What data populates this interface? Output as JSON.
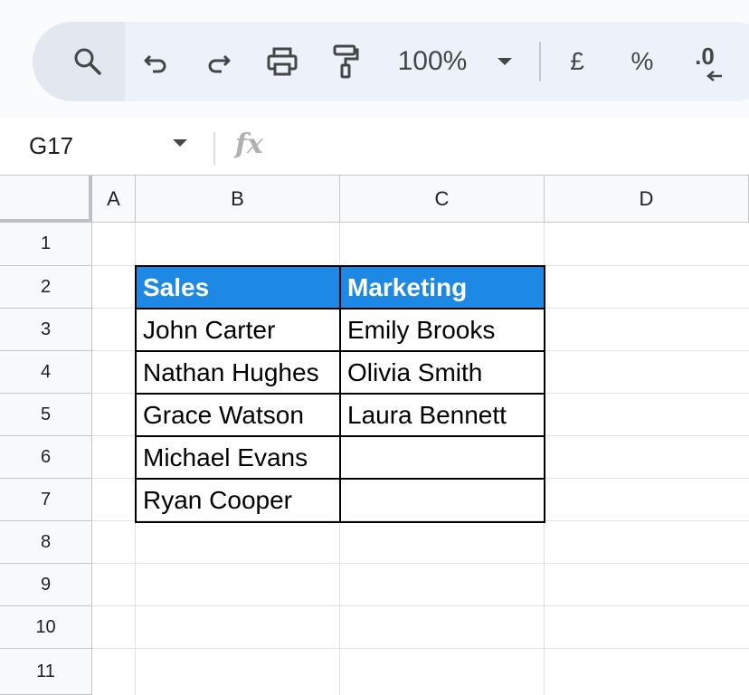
{
  "toolbar": {
    "zoom": "100%",
    "currency_symbol": "£",
    "percent_symbol": "%",
    "decimal_symbol": ".0"
  },
  "formula_bar": {
    "name_box": "G17",
    "fx_label": "fx"
  },
  "columns": [
    "A",
    "B",
    "C",
    "D"
  ],
  "rows": [
    "1",
    "2",
    "3",
    "4",
    "5",
    "6",
    "7",
    "8",
    "9",
    "10",
    "11"
  ],
  "table": {
    "headers": [
      "Sales",
      "Marketing"
    ],
    "rows": [
      [
        "John Carter",
        "Emily Brooks"
      ],
      [
        "Nathan Hughes",
        "Olivia Smith"
      ],
      [
        "Grace Watson",
        "Laura Bennett"
      ],
      [
        "Michael Evans",
        ""
      ],
      [
        "Ryan Cooper",
        ""
      ]
    ]
  },
  "colors": {
    "header_fill": "#1e88e5",
    "header_text": "#ffffff",
    "toolbar_bg": "#edf2fa"
  }
}
